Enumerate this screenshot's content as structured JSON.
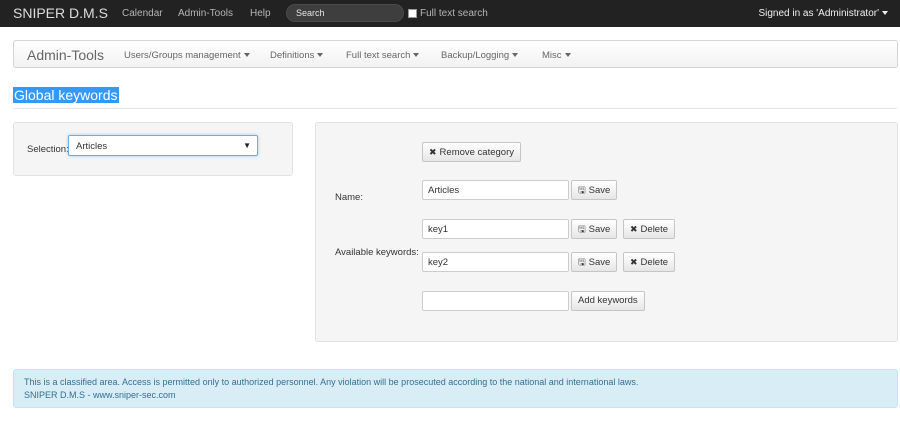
{
  "navbar": {
    "brand": "SNIPER D.M.S",
    "links": [
      "Calendar",
      "Admin-Tools",
      "Help"
    ],
    "search_placeholder": "Search",
    "full_text_label": "Full text search",
    "signed_in": "Signed in as 'Administrator'"
  },
  "adminbar": {
    "brand": "Admin-Tools",
    "menus": [
      "Users/Groups management",
      "Definitions",
      "Full text search",
      "Backup/Logging",
      "Misc"
    ]
  },
  "page": {
    "title": "Global keywords"
  },
  "selection": {
    "label": "Selection:",
    "value": "Articles"
  },
  "category": {
    "remove_label": "Remove category",
    "name_label": "Name:",
    "name_value": "Articles",
    "save_label": "Save",
    "keywords_label": "Available keywords:",
    "keywords": [
      "key1",
      "key2"
    ],
    "delete_label": "Delete",
    "new_keyword_value": "",
    "add_label": "Add keywords"
  },
  "footer": {
    "notice": "This is a classified area. Access is permitted only to authorized personnel. Any violation will be prosecuted according to the national and international laws.",
    "credit": "SNIPER D.M.S - www.sniper-sec.com"
  },
  "colors": {
    "navbar_bg": "#222222",
    "highlight": "#3399ff",
    "info_bg": "#d9edf7",
    "info_text": "#31708f"
  },
  "icons": {
    "remove": "x-icon",
    "save": "floppy-disk-icon",
    "delete": "x-icon",
    "dropdown": "caret-down-icon",
    "select": "triangle-down-icon"
  }
}
